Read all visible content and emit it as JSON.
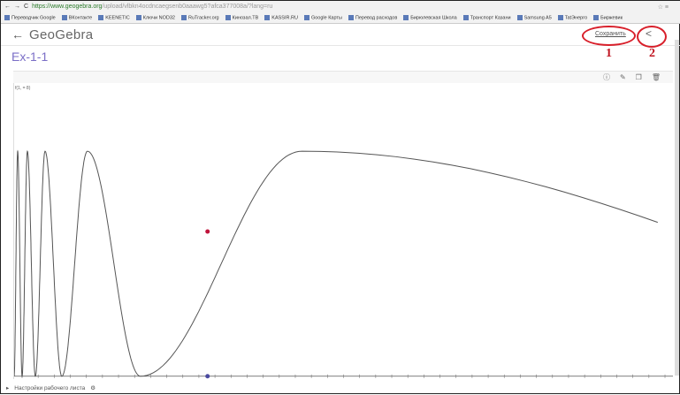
{
  "browser": {
    "url_host": "https://www.geogebra.org",
    "url_rest": "/upload/vlbkn4ocdncaegsenb0aaawg5?afca377008a/?lang=ru",
    "bookmarks": [
      "Переводчик Google",
      "ВКонтакте",
      "KEENETIC",
      "Ключи NOD32",
      "RuTracker.org",
      "Кинозал.ТВ",
      "KASSIR.RU",
      "Google Карты",
      "Перевод расходов",
      "Бирюлевская Школа",
      "Транспорт Казани",
      "Samsung A5",
      "TatЭнерго",
      "Биржевик"
    ]
  },
  "header": {
    "back": "←",
    "logo": "GeoGebra",
    "save_label": "Сохранить",
    "share_icon": "<"
  },
  "annotations": {
    "one": "1",
    "two": "2"
  },
  "title": "Ex-1-1",
  "graphics": {
    "function_label": "f(1, = 8)",
    "point_color": "#c0143c",
    "axis_point_color": "#4a4aa0"
  },
  "footer": {
    "settings_label": "Настройки рабочего листа"
  }
}
